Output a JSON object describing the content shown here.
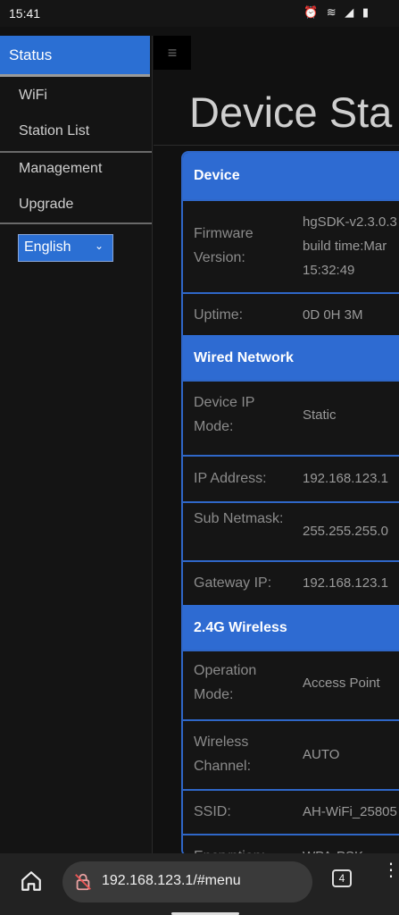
{
  "status_bar": {
    "time": "15:41",
    "icons_text": "⏰ ≋ ◢ ▮"
  },
  "sidebar": {
    "active": "Status",
    "items": [
      "WiFi",
      "Station List",
      "Management",
      "Upgrade"
    ],
    "language": "English"
  },
  "page": {
    "title": "Device Sta",
    "menu_icon": "≡"
  },
  "sections": {
    "device": {
      "header": "Device",
      "firmware_label": "Firmware Version:",
      "firmware_lines": [
        "hgSDK-v2.3.0.3",
        "build time:Mar",
        "15:32:49"
      ],
      "uptime_label": "Uptime:",
      "uptime_value": "0D 0H 3M"
    },
    "wired": {
      "header": "Wired Network",
      "ipmode_label": "Device IP Mode:",
      "ipmode_value": "Static",
      "ip_label": "IP Address:",
      "ip_value": "192.168.123.1",
      "mask_label": "Sub Netmask:",
      "mask_value": "255.255.255.0",
      "gw_label": "Gateway IP:",
      "gw_value": "192.168.123.1"
    },
    "wireless": {
      "header": "2.4G Wireless",
      "opmode_label": "Operation Mode:",
      "opmode_value": "Access Point",
      "channel_label": "Wireless Channel:",
      "channel_value": "AUTO",
      "ssid_label": "SSID:",
      "ssid_value": "AH-WiFi_25805",
      "enc_label": "Encryption:",
      "enc_value": "WPA-PSK"
    }
  },
  "browser": {
    "url": "192.168.123.1/#menu",
    "tab_count": "4"
  }
}
